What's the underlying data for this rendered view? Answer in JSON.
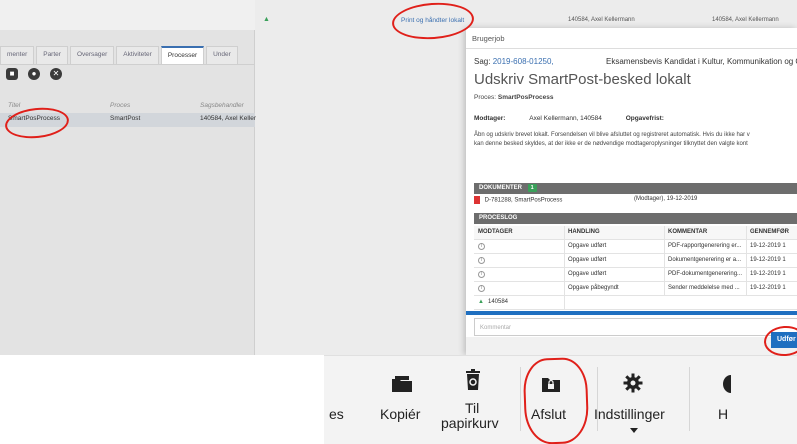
{
  "left_pane": {
    "tabs": [
      "menter",
      "Parter",
      "Oversager",
      "Aktiviteter",
      "Processer",
      "Under"
    ],
    "active_tab_index": 4,
    "grid_headers": {
      "titel": "Titel",
      "proces": "Proces",
      "sagsbehandler": "Sagsbehandler"
    },
    "rows": [
      {
        "titel": "SmartPosProcess",
        "proces": "SmartPost",
        "sagsbehandler": "140584, Axel Keller"
      }
    ]
  },
  "top_bar": {
    "print_link": "Print og håndter lokalt",
    "info1": "140584, Axel Kellermann",
    "info2": "140584, Axel Kellermann"
  },
  "modal": {
    "title": "Brugerjob",
    "sag_label": "Sag:",
    "sag_number": "2019-608-01250,",
    "sag_description": "Eksamensbevis Kandidat i Kultur, Kommunikation og G",
    "heading": "Udskriv SmartPost-besked lokalt",
    "proces_label": "Proces:",
    "proces_value": "SmartPosProcess",
    "modtager_label": "Modtager:",
    "modtager_value": "Axel Kellermann, 140584",
    "opgavefrist_label": "Opgavefrist:",
    "info_line1": "Åbn og udskriv brevet lokalt. Forsendelsen vil blive afsluttet og registreret automatisk. Hvis du ikke har v",
    "info_line2": "kan denne besked skyldes, at der ikke er de nødvendige modtageroplysninger tilknyttet den valgte kont",
    "documents_title": "DOKUMENTER",
    "documents_count": "1",
    "document": {
      "name": "D-781288, SmartPosProcess",
      "meta": "(Modtager), 19-12-2019"
    },
    "proceslog_title": "PROCESLOG",
    "proceslog_headers": {
      "modtager": "MODTAGER",
      "handling": "HANDLING",
      "kommentar": "KOMMENTAR",
      "gennemfort": "GENNEMFØR"
    },
    "proceslog_rows": [
      {
        "handling": "Opgave udført",
        "kommentar": "PDF-rapportgenerering er...",
        "gennemfort": "19-12-2019 1"
      },
      {
        "handling": "Opgave udført",
        "kommentar": "Dokumentgenerering er a...",
        "gennemfort": "19-12-2019 1"
      },
      {
        "handling": "Opgave udført",
        "kommentar": "PDF-dokumentgenerering...",
        "gennemfort": "19-12-2019 1"
      },
      {
        "handling": "Opgave påbegyndt",
        "kommentar": "Sender meddelelse med ...",
        "gennemfort": "19-12-2019 1"
      }
    ],
    "proceslog_user": "140584",
    "comment_placeholder": "Kommentar",
    "udfor_label": "Udfør"
  },
  "ribbon": {
    "partial_label": "es",
    "copy_label": "Kopiér",
    "recycle_label_1": "Til",
    "recycle_label_2": "papirkurv",
    "close_label": "Afslut",
    "settings_label": "Indstillinger",
    "help_label_partial": "H"
  },
  "colors": {
    "accent_blue": "#1f6fc0",
    "annotation_red": "#e0201a",
    "badge_green": "#3aa05a"
  }
}
